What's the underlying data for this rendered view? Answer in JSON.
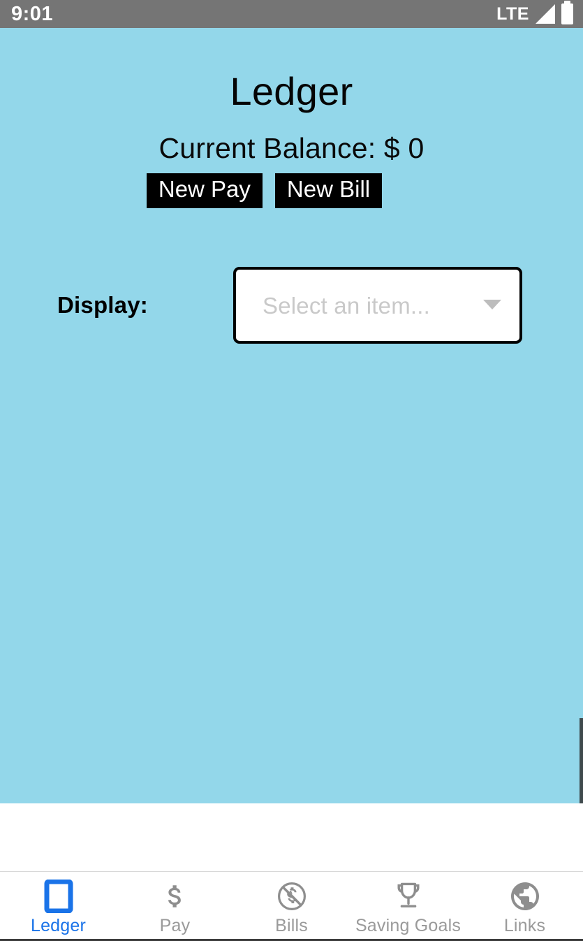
{
  "status_bar": {
    "time": "9:01",
    "network": "LTE",
    "signal_icon": "signal-cellular-icon",
    "battery_icon": "battery-full-icon"
  },
  "screen": {
    "title": "Ledger",
    "background_color": "#93d7ea",
    "balance_text": "Current Balance: $ 0",
    "buttons": [
      {
        "label": "New Pay",
        "name": "new-pay-button"
      },
      {
        "label": "New Bill",
        "name": "new-bill-button"
      }
    ],
    "display_label": "Display:",
    "select": {
      "placeholder": "Select an item...",
      "value": "",
      "caret_icon": "chevron-down-icon"
    }
  },
  "bottom_nav": {
    "active_color": "#1a73e8",
    "inactive_color": "#9a9a9a",
    "items": [
      {
        "label": "Ledger",
        "icon": "book-outline-icon",
        "active": true
      },
      {
        "label": "Pay",
        "icon": "dollar-sign-icon",
        "active": false
      },
      {
        "label": "Bills",
        "icon": "money-off-icon",
        "active": false
      },
      {
        "label": "Saving Goals",
        "icon": "trophy-icon",
        "active": false
      },
      {
        "label": "Links",
        "icon": "globe-icon",
        "active": false
      }
    ]
  }
}
